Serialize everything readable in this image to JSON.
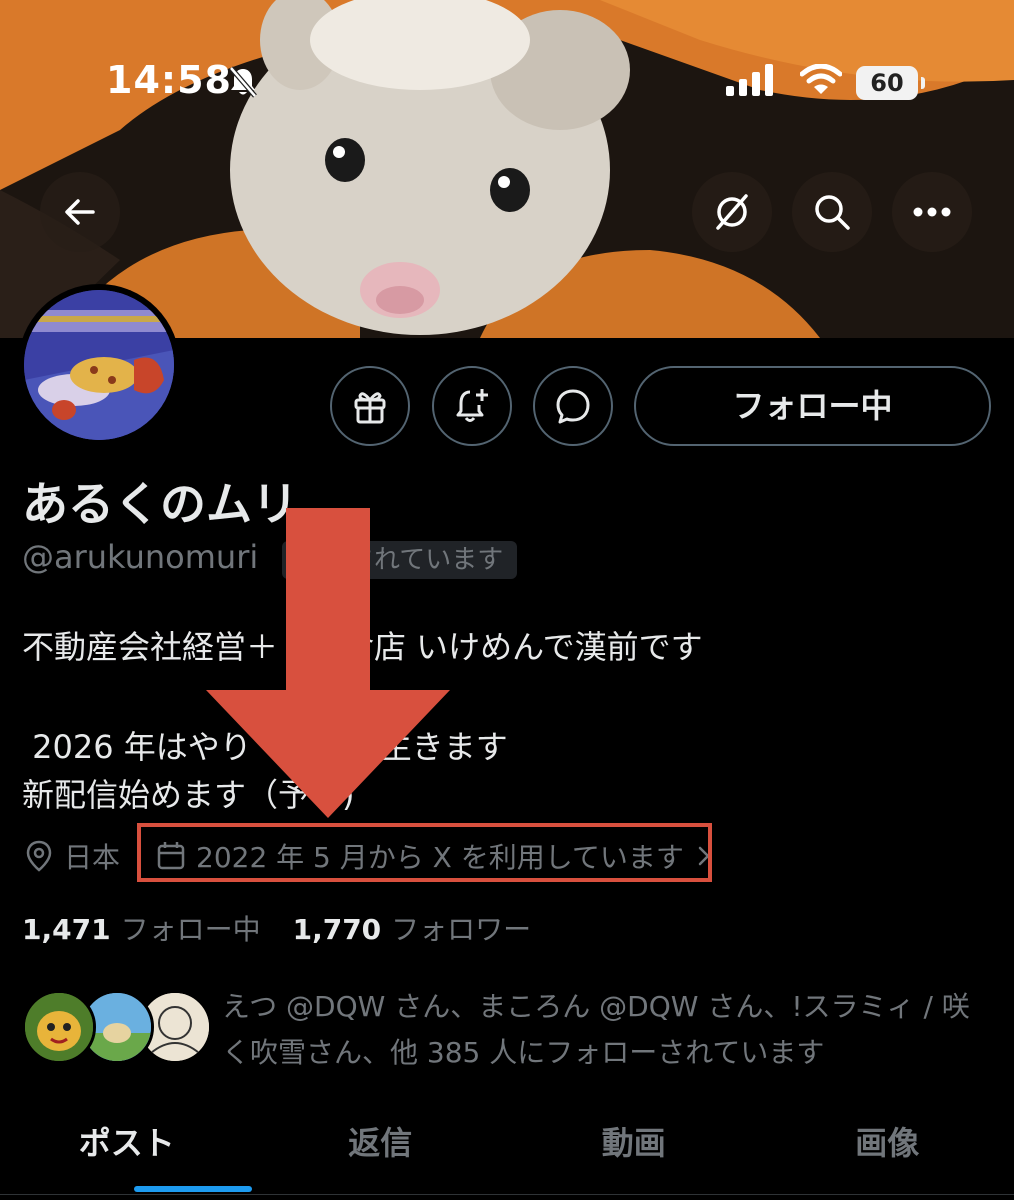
{
  "status_bar": {
    "time": "14:58",
    "battery": "60",
    "icons": [
      "bell-slash-icon",
      "cellular-signal-icon",
      "wifi-icon",
      "battery-icon"
    ]
  },
  "banner": {
    "description_icons": [
      "back-arrow-icon",
      "grok-icon",
      "search-icon",
      "more-icon"
    ],
    "colors": {
      "orange": "#e0822a",
      "overlay": "#281e18"
    }
  },
  "profile": {
    "display_name": "あるくのムリ",
    "handle": "@arukunomuri",
    "follows_you": "ローされています",
    "bio_lines": [
      "不動産会社経営＋　飲食店 いけめんで漢前です",
      " 2026 年はやり　　　に生きます",
      "新配信始めます（予　)"
    ],
    "location": "日本",
    "joined": "2022 年 5 月から X を利用しています",
    "following_count": "1,471",
    "following_label": "フォロー中",
    "followers_count": "1,770",
    "followers_label": "フォロワー",
    "followed_by": "えつ @DQW さん、まころん @DQW さん、!スラミィ / 咲く吹雪さん、他 385 人にフォローされています"
  },
  "actions": {
    "follow_button": "フォロー中",
    "icons": [
      "gift-icon",
      "notification-add-icon",
      "message-icon"
    ]
  },
  "tabs": [
    {
      "label": "ポスト",
      "active": true
    },
    {
      "label": "返信",
      "active": false
    },
    {
      "label": "動画",
      "active": false
    },
    {
      "label": "画像",
      "active": false
    }
  ],
  "colors": {
    "background": "#000000",
    "text": "#e7e9ea",
    "muted": "#71767b",
    "accent": "#1d9bf0",
    "annotation": "#d8503e"
  }
}
